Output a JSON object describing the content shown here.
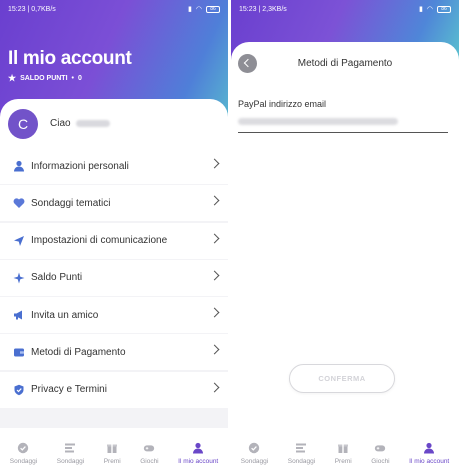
{
  "left": {
    "status": {
      "time": "15:23",
      "speed": "0,7KB/s",
      "battery": "86"
    },
    "title": "Il mio account",
    "points_label": "SALDO PUNTI",
    "points_value": "0",
    "avatar_letter": "C",
    "greeting": "Ciao",
    "menu": [
      {
        "label": "Informazioni personali",
        "icon": "person-icon"
      },
      {
        "label": "Sondaggi tematici",
        "icon": "heart-icon"
      },
      {
        "label": "Impostazioni di comunicazione",
        "icon": "send-icon"
      },
      {
        "label": "Saldo Punti",
        "icon": "sparkle-icon"
      },
      {
        "label": "Invita un amico",
        "icon": "megaphone-icon"
      },
      {
        "label": "Metodi di Pagamento",
        "icon": "wallet-icon"
      },
      {
        "label": "Privacy e Termini",
        "icon": "shield-icon"
      }
    ],
    "tabs": [
      {
        "label": "Sondaggi",
        "icon": "check-circle-icon",
        "active": false
      },
      {
        "label": "Sondaggi",
        "icon": "list-icon",
        "active": false
      },
      {
        "label": "Premi",
        "icon": "gift-icon",
        "active": false
      },
      {
        "label": "Giochi",
        "icon": "gamepad-icon",
        "active": false
      },
      {
        "label": "Il mio account",
        "icon": "user-icon",
        "active": true
      }
    ]
  },
  "right": {
    "status": {
      "time": "15:23",
      "speed": "2,3KB/s",
      "battery": "86"
    },
    "title": "Metodi di Pagamento",
    "field_label": "PayPal indirizzo email",
    "confirm_label": "CONFERMA",
    "tabs": [
      {
        "label": "Sondaggi",
        "icon": "check-circle-icon",
        "active": false
      },
      {
        "label": "Sondaggi",
        "icon": "list-icon",
        "active": false
      },
      {
        "label": "Premi",
        "icon": "gift-icon",
        "active": false
      },
      {
        "label": "Giochi",
        "icon": "gamepad-icon",
        "active": false
      },
      {
        "label": "Il mio account",
        "icon": "user-icon",
        "active": true
      }
    ]
  },
  "colors": {
    "brand_purple": "#6a47c8",
    "gradient_teal": "#58b8cf",
    "icon_blue": "#4a6fd0"
  }
}
